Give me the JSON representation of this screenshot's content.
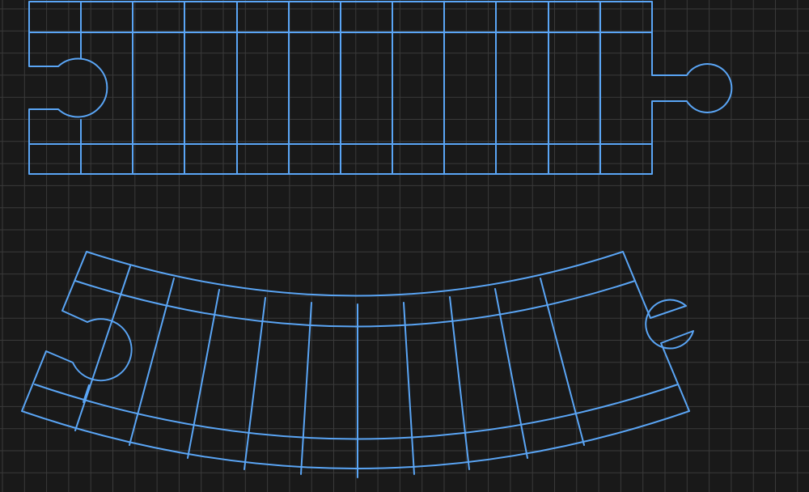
{
  "canvas": {
    "background_color": "#191919",
    "grid_color": "#3a3a3a",
    "grid_visible": true
  },
  "pieces": [
    {
      "id": "straight-track",
      "kind": "straight",
      "stroke_color": "#5aa5f5",
      "peg_connector": "right",
      "socket_connector": "left",
      "sleeper_count": 12
    },
    {
      "id": "curved-track",
      "kind": "curved",
      "stroke_color": "#5aa5f5",
      "peg_connector": "right",
      "socket_connector": "left",
      "sleeper_count": 12
    }
  ]
}
